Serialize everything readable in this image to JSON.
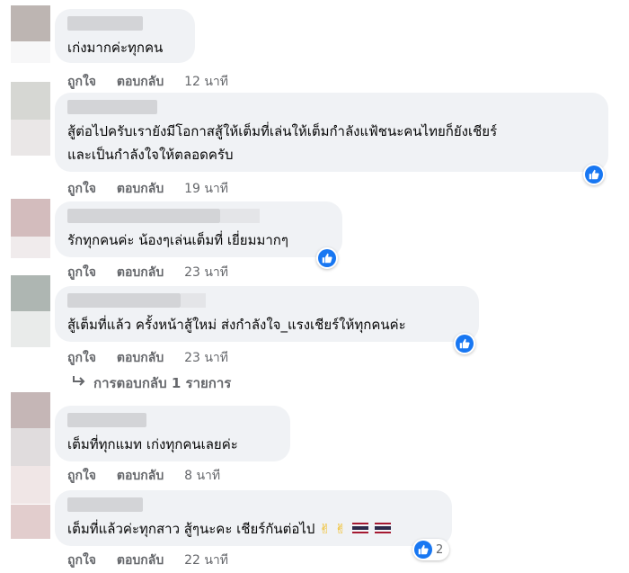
{
  "comments": [
    {
      "text": "เก่งมากค่ะทุกคน",
      "like": "ถูกใจ",
      "reply": "ตอบกลับ",
      "time": "12 นาที"
    },
    {
      "text_line1": "สู้ต่อไปครับเรายังมีโอกาสสู้ให้เต็มที่เล่นให้เต็มกำลังแฟ้ชนะคนไทยก็ยังเชียร์",
      "text_line2": "และเป็นกำลังใจให้ตลอดครับ",
      "like": "ถูกใจ",
      "reply": "ตอบกลับ",
      "time": "19 นาที"
    },
    {
      "text": "รักทุกคนค่ะ น้องๆเล่นเต็มที่ เยี่ยมมากๆ",
      "like": "ถูกใจ",
      "reply": "ตอบกลับ",
      "time": "23 นาที"
    },
    {
      "text": "สู้เต็มที่แล้ว ครั้งหน้าสู้ใหม่ ส่งกำลังใจ_แรงเชียร์ให้ทุกคนค่ะ",
      "like": "ถูกใจ",
      "reply": "ตอบกลับ",
      "time": "23 นาที"
    },
    {
      "text": "เต็มที่ทุกแมท เก่งทุกคนเลยค่ะ",
      "like": "ถูกใจ",
      "reply": "ตอบกลับ",
      "time": "8 นาที"
    },
    {
      "text": "เต็มที่แล้วค่ะทุกสาว สู้ๆนะคะ เชียร์กันต่อไป",
      "like": "ถูกใจ",
      "reply": "ตอบกลับ",
      "time": "22 นาที",
      "reaction_count": "2"
    }
  ],
  "view_replies": "การตอบกลับ 1 รายการ",
  "emoji": {
    "victory": "✌",
    "flag": "thailand-flag"
  },
  "colors": {
    "bubble": "#f0f2f5",
    "like_blue": "#1877f2",
    "meta_gray": "#65676b"
  }
}
